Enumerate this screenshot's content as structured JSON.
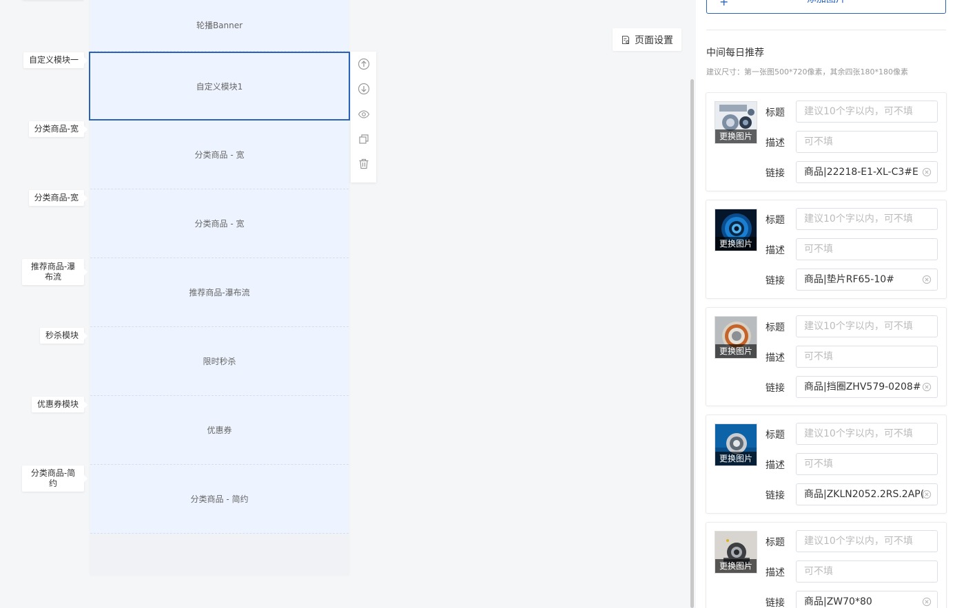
{
  "side_labels": [
    "自定义模块一",
    "分类商品-宽",
    "分类商品-宽",
    "推荐商品-瀑布流",
    "秒杀模块",
    "优惠券模块",
    "分类商品-简约"
  ],
  "modules": [
    "轮播Banner",
    "自定义模块1",
    "分类商品 - 宽",
    "分类商品 - 宽",
    "推荐商品-瀑布流",
    "限时秒杀",
    "优惠券",
    "分类商品 - 简约"
  ],
  "toolbar": {
    "move_up": "arrow-up-circle-icon",
    "move_down": "arrow-down-circle-icon",
    "toggle_visibility": "eye-icon",
    "duplicate": "copy-icon",
    "delete": "trash-icon"
  },
  "page_setting": {
    "label": "页面设置"
  },
  "panel": {
    "add_image": "添加图片",
    "section_title": "中间每日推荐",
    "section_hint": "建议尺寸：第一张图500*720像素，其余四张180*180像素",
    "labels": {
      "title": "标题",
      "desc": "描述",
      "link": "链接"
    },
    "placeholders": {
      "title": "建议10个字以内，可不填",
      "desc": "可不填"
    },
    "change_image": "更换图片",
    "cards": [
      {
        "link": "商品|22218-E1-XL-C3#E"
      },
      {
        "link": "商品|垫片RF65-10#"
      },
      {
        "link": "商品|挡圈ZHV579-0208#"
      },
      {
        "link": "商品|ZKLN2052.2RS.2AP("
      },
      {
        "link": "商品|ZW70*80"
      }
    ]
  },
  "colors": {
    "accent": "#2a62b8",
    "module_bg": "#edf4ff"
  }
}
